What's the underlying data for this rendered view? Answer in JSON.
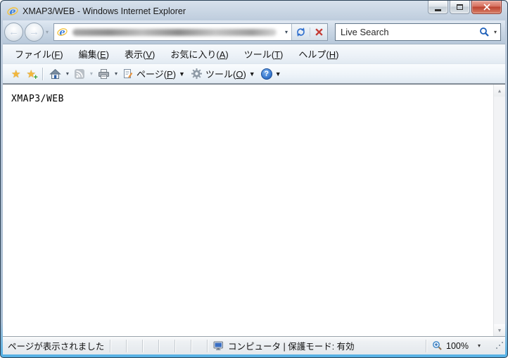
{
  "window": {
    "title": "XMAP3/WEB - Windows Internet Explorer"
  },
  "navigation": {
    "search_placeholder": "Live Search"
  },
  "menu_bar": {
    "items": [
      {
        "pre": "ファイル(",
        "key": "F",
        "post": ")"
      },
      {
        "pre": "編集(",
        "key": "E",
        "post": ")"
      },
      {
        "pre": "表示(",
        "key": "V",
        "post": ")"
      },
      {
        "pre": "お気に入り(",
        "key": "A",
        "post": ")"
      },
      {
        "pre": "ツール(",
        "key": "T",
        "post": ")"
      },
      {
        "pre": "ヘルプ(",
        "key": "H",
        "post": ")"
      }
    ]
  },
  "command_bar": {
    "page": {
      "pre": "ページ(",
      "key": "P",
      "post": ")"
    },
    "tools": {
      "pre": "ツール(",
      "key": "O",
      "post": ")"
    }
  },
  "content": {
    "text": "XMAP3/WEB"
  },
  "status_bar": {
    "message": "ページが表示されました",
    "zone": "コンピュータ | 保護モード: 有効",
    "zoom": "100%"
  },
  "icons": {
    "dropdown_small": "▾",
    "dropdown": "▼",
    "back_arrow": "←",
    "forward_arrow": "→",
    "star": "★",
    "plus": "+",
    "help_q": "?",
    "scroll_up": "▲",
    "scroll_down": "▼"
  },
  "colors": {
    "titlebar": "#bccbdc",
    "close_button_red": "#bc4330",
    "search_icon_blue": "#1d5fb8",
    "star_gold": "#f3b73a",
    "frame_bottom_accent": "#57b1e4"
  }
}
